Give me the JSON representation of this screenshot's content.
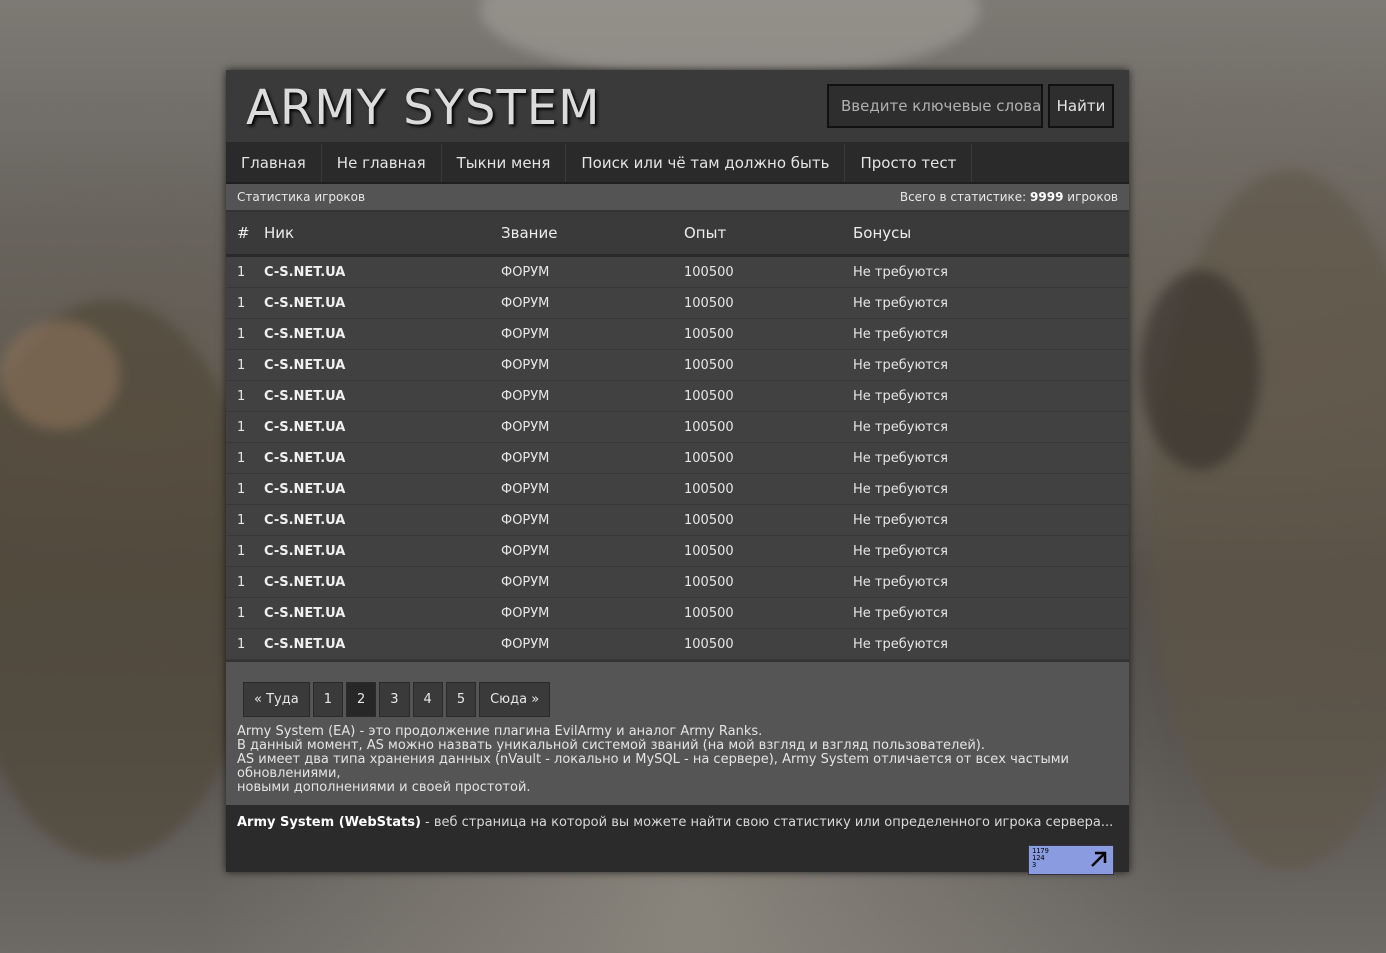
{
  "header": {
    "logo": "ARMY SYSTEM",
    "search_placeholder": "Введите ключевые слова",
    "search_button": "Найти"
  },
  "nav": {
    "items": [
      {
        "label": "Главная"
      },
      {
        "label": "Не главная"
      },
      {
        "label": "Тыкни меня"
      },
      {
        "label": "Поиск или чё там должно быть"
      },
      {
        "label": "Просто тест"
      }
    ]
  },
  "stats_bar": {
    "left": "Статистика игроков",
    "total_prefix": "Всего в статистике:",
    "total_count": "9999",
    "total_suffix": "игроков"
  },
  "table": {
    "headers": {
      "num": "#",
      "nick": "Ник",
      "rank": "Звание",
      "exp": "Опыт",
      "bonus": "Бонусы"
    },
    "rows": [
      {
        "num": "1",
        "nick": "C-S.NET.UA",
        "rank": "ФОРУМ",
        "exp": "100500",
        "bonus": "Не требуются"
      },
      {
        "num": "1",
        "nick": "C-S.NET.UA",
        "rank": "ФОРУМ",
        "exp": "100500",
        "bonus": "Не требуются"
      },
      {
        "num": "1",
        "nick": "C-S.NET.UA",
        "rank": "ФОРУМ",
        "exp": "100500",
        "bonus": "Не требуются"
      },
      {
        "num": "1",
        "nick": "C-S.NET.UA",
        "rank": "ФОРУМ",
        "exp": "100500",
        "bonus": "Не требуются"
      },
      {
        "num": "1",
        "nick": "C-S.NET.UA",
        "rank": "ФОРУМ",
        "exp": "100500",
        "bonus": "Не требуются"
      },
      {
        "num": "1",
        "nick": "C-S.NET.UA",
        "rank": "ФОРУМ",
        "exp": "100500",
        "bonus": "Не требуются"
      },
      {
        "num": "1",
        "nick": "C-S.NET.UA",
        "rank": "ФОРУМ",
        "exp": "100500",
        "bonus": "Не требуются"
      },
      {
        "num": "1",
        "nick": "C-S.NET.UA",
        "rank": "ФОРУМ",
        "exp": "100500",
        "bonus": "Не требуются"
      },
      {
        "num": "1",
        "nick": "C-S.NET.UA",
        "rank": "ФОРУМ",
        "exp": "100500",
        "bonus": "Не требуются"
      },
      {
        "num": "1",
        "nick": "C-S.NET.UA",
        "rank": "ФОРУМ",
        "exp": "100500",
        "bonus": "Не требуются"
      },
      {
        "num": "1",
        "nick": "C-S.NET.UA",
        "rank": "ФОРУМ",
        "exp": "100500",
        "bonus": "Не требуются"
      },
      {
        "num": "1",
        "nick": "C-S.NET.UA",
        "rank": "ФОРУМ",
        "exp": "100500",
        "bonus": "Не требуются"
      },
      {
        "num": "1",
        "nick": "C-S.NET.UA",
        "rank": "ФОРУМ",
        "exp": "100500",
        "bonus": "Не требуются"
      }
    ]
  },
  "pagination": {
    "prev": "« Туда",
    "pages": [
      "1",
      "2",
      "3",
      "4",
      "5"
    ],
    "active": "2",
    "next": "Сюда »"
  },
  "description": {
    "lines": [
      "Army System (EA) - это продолжение плагина EvilArmy и аналог Army Ranks.",
      "В данный момент, AS можно назвать уникальной системой званий (на мой взгляд и взгляд пользователей).",
      "AS имеет два типа хранения данных (nVault - локально и MySQL - на сервере), Army System отличается от всех частыми обновлениями,",
      "новыми дополнениями и своей простотой."
    ]
  },
  "footer": {
    "title": "Army System (WebStats)",
    "text": "- веб страница на которой вы можете найти свою статистику или определенного игрока сервера..."
  },
  "counter": {
    "line1": "1179",
    "line2": "124",
    "line3": "3",
    "color": "#8a9be0",
    "icon": "arrow-up-right-icon"
  }
}
